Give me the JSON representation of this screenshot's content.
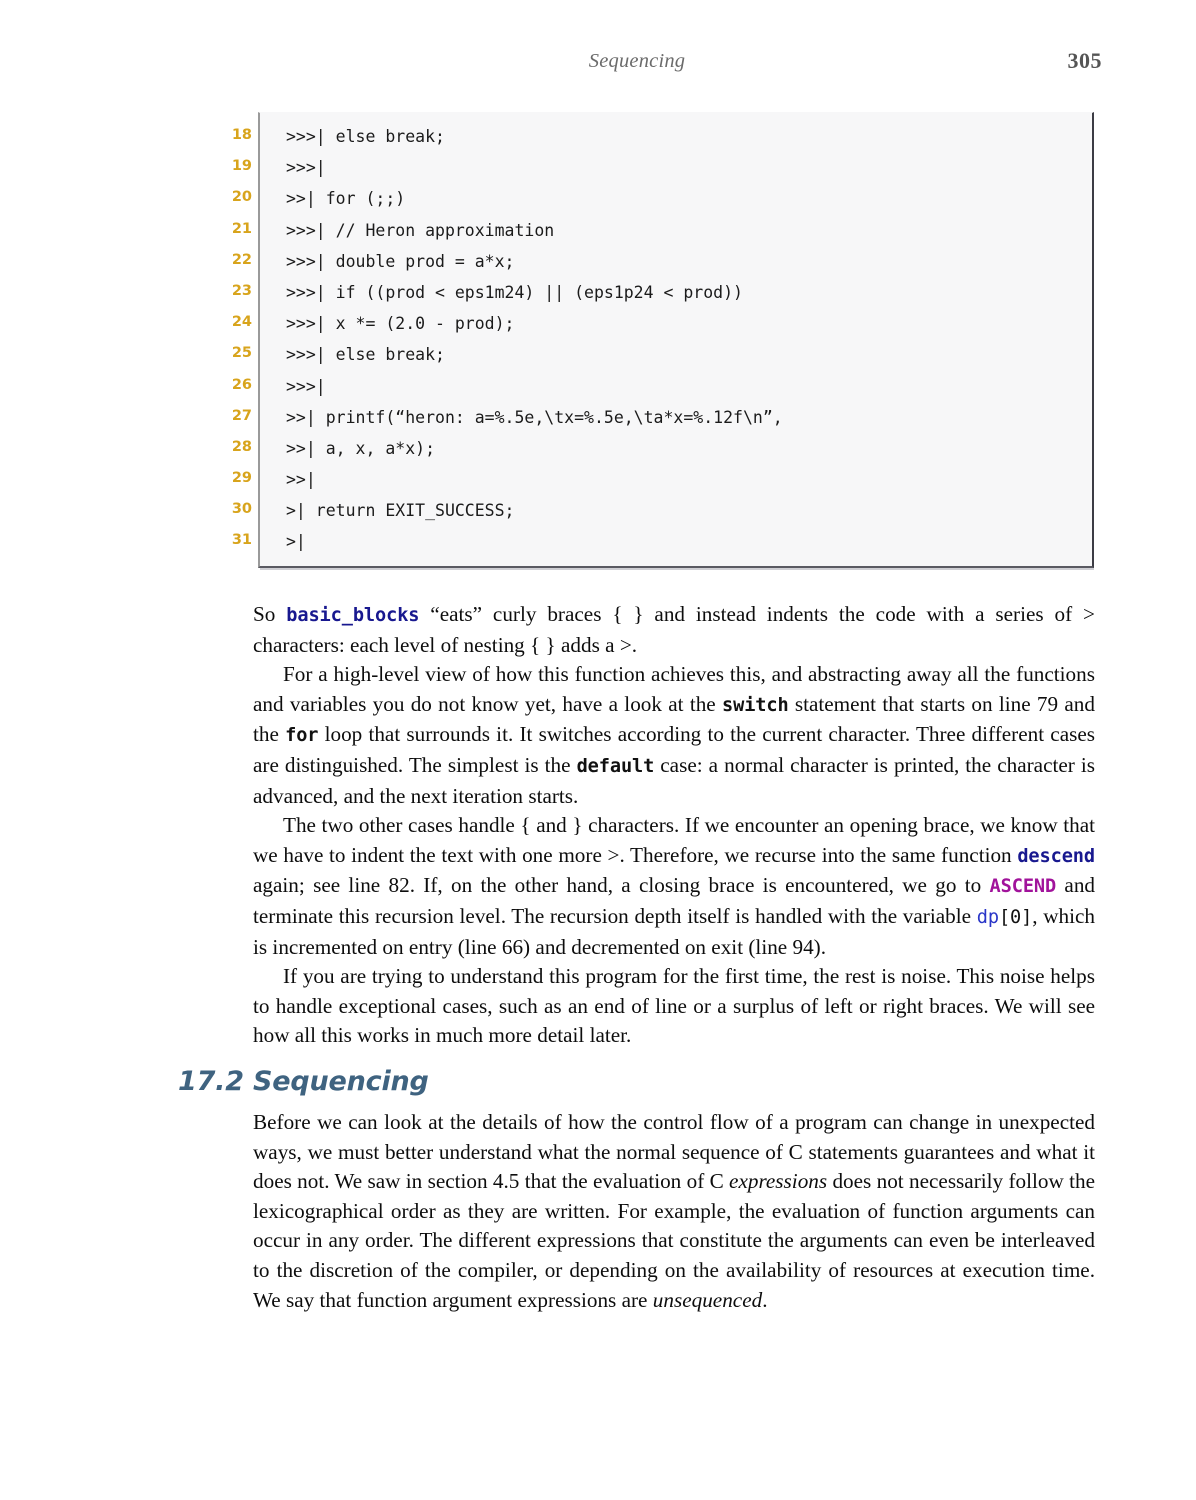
{
  "header": {
    "title": "Sequencing",
    "page_number": "305"
  },
  "listing": {
    "lines": [
      {
        "no": "18",
        "code": ">>>| else break;"
      },
      {
        "no": "19",
        "code": ">>>|"
      },
      {
        "no": "20",
        "code": ">>| for (;;)"
      },
      {
        "no": "21",
        "code": ">>>| // Heron approximation"
      },
      {
        "no": "22",
        "code": ">>>| double prod = a*x;"
      },
      {
        "no": "23",
        "code": ">>>| if ((prod < eps1m24) || (eps1p24 < prod))"
      },
      {
        "no": "24",
        "code": ">>>| x *= (2.0 - prod);"
      },
      {
        "no": "25",
        "code": ">>>| else break;"
      },
      {
        "no": "26",
        "code": ">>>|"
      },
      {
        "no": "27",
        "code": ">>| printf(“heron: a=%.5e,\\tx=%.5e,\\ta*x=%.12f\\n”,"
      },
      {
        "no": "28",
        "code": ">>| a, x, a*x);"
      },
      {
        "no": "29",
        "code": ">>|"
      },
      {
        "no": "30",
        "code": ">| return EXIT_SUCCESS;"
      },
      {
        "no": "31",
        "code": ">|"
      }
    ]
  },
  "paragraphs": {
    "p1": {
      "a": "So ",
      "code1": "basic_blocks",
      "b": " “eats” curly braces { } and instead indents the code with a series of > characters: each level of nesting { } adds a >."
    },
    "p2": {
      "a": "For a high-level view of how this function achieves this, and abstracting away all the functions and variables you do not know yet, have a look at the ",
      "code1": "switch",
      "b": " statement that starts on line 79 and the ",
      "code2": "for",
      "c": " loop that surrounds it.  It switches according to the current character.  Three different cases are distinguished.  The simplest is the ",
      "code3": "default",
      "d": " case: a normal character is printed, the character is advanced, and the next iteration starts."
    },
    "p3": {
      "a": "The two other cases handle { and } characters. If we encounter an opening brace, we know that we have to indent the text with one more >. Therefore, we recurse into the same function ",
      "code1": "descend",
      "b": " again; see line 82.  If, on the other hand, a closing brace is encountered, we go to ",
      "code2": "ASCEND",
      "c": " and terminate this recursion level. The recursion depth itself is handled with the variable ",
      "code3": "dp",
      "code4": "[0]",
      "d": ", which is incremented on entry (line 66) and decremented on exit (line 94)."
    },
    "p4": {
      "a": "If you are trying to understand this program for the first time, the rest is noise.  This noise helps to handle exceptional cases, such as an end of line or a surplus of left or right braces. We will see how all this works in much more detail later."
    },
    "p5": {
      "a": "Before we can look at the details of how the control flow of a program can change in unexpected ways, we must better understand what the normal sequence of C statements guarantees and what it does not.  We saw in section 4.5 that the evaluation of C ",
      "em1": "expressions",
      "b": " does not necessarily follow the lexicographical order as they are written. For example, the evaluation of function arguments can occur in any order. The different expressions that constitute the arguments can even be interleaved to the discretion of the compiler, or depending on the availability of resources at execution time.  We say that function argument expressions are ",
      "em2": "unsequenced",
      "c": "."
    }
  },
  "section": {
    "number": "17.2",
    "title": "Sequencing"
  },
  "colors": {
    "lineno": "#d8a41c",
    "heading": "#3f6380",
    "code_blue": "#18188f",
    "code_magenta": "#a1139b",
    "code_blue_light": "#2a36c8",
    "code_bg": "#f7f7f8"
  }
}
